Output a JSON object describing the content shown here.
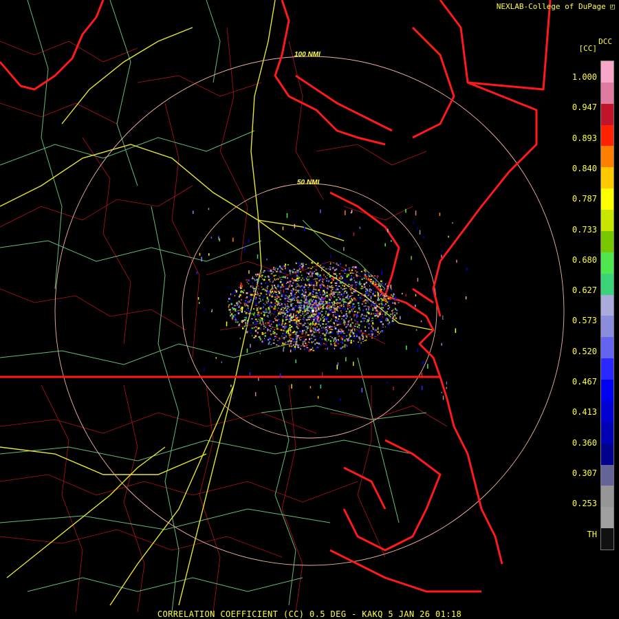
{
  "header": {
    "credit": "NEXLAB-College of DuPage",
    "credit_icon": "arrow-icon"
  },
  "footer": {
    "caption": "CORRELATION COEFFICIENT (CC) 0.5 DEG - KAKQ 5 JAN 26 01:18"
  },
  "range_rings": [
    {
      "label": "50 NMI"
    },
    {
      "label": "100 NMI"
    }
  ],
  "legend": {
    "product_code": "DCC",
    "unit": "[CC]",
    "labels": [
      "1.000",
      "0.947",
      "0.893",
      "0.840",
      "0.787",
      "0.733",
      "0.680",
      "0.627",
      "0.573",
      "0.520",
      "0.467",
      "0.413",
      "0.360",
      "0.307",
      "0.253",
      "TH"
    ],
    "swatches": [
      "#f7a5c8",
      "#e07aa0",
      "#c0142a",
      "#ff2200",
      "#ff8000",
      "#ffc800",
      "#ffff00",
      "#c8e600",
      "#78c800",
      "#50e650",
      "#3cd278",
      "#aaaadc",
      "#8c8cdc",
      "#6464f0",
      "#2828ff",
      "#0000f0",
      "#0000d2",
      "#0000b4",
      "#00008c",
      "#646496",
      "#969696",
      "#a0a0a0",
      "#111111"
    ]
  },
  "colors": {
    "state_border": "#ff1a1a",
    "county_border": "#c8141e",
    "road_primary": "#e6e632",
    "road_secondary": "#78dc8c",
    "range_ring": "#f0b4a0",
    "text": "#ffff3c"
  }
}
